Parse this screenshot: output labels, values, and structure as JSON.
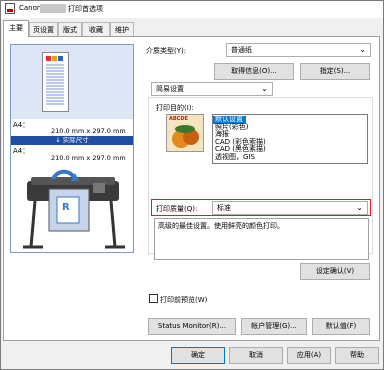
{
  "window": {
    "title_app": "Canon",
    "title_suffix": "打印首选项"
  },
  "tabs": [
    {
      "label": "主要"
    },
    {
      "label": "页设置"
    },
    {
      "label": "版式"
    },
    {
      "label": "收藏"
    },
    {
      "label": "维护"
    }
  ],
  "preview": {
    "info_line1_label": "A4：",
    "info_line1_size": "210.0 mm x 297.0 mm",
    "actual_size_label": "↓ 实际尺寸",
    "info_line2_label": "A4：",
    "info_line2_size": "210.0 mm x 297.0 mm",
    "printer_panel_letter": "R"
  },
  "media": {
    "label": "介质类型(Y):",
    "value": "普通纸",
    "get_info_button": "取得信息(O)...",
    "specify_button": "指定(S)..."
  },
  "mode": {
    "value": "简易设置"
  },
  "purpose": {
    "label": "打印目的(I):",
    "thumbnail_caption": "ABCDE",
    "options": [
      "默认设置",
      "照片(彩色)",
      "海报",
      "CAD (彩色索描)",
      "CAD (黑色素描)",
      "透视图，GIS"
    ],
    "selected_index": 0
  },
  "quality": {
    "label": "打印质量(Q):",
    "value": "标准",
    "description": "高级的最佳设置。使用鲜亮的颜色打印。",
    "confirm_button": "设定确认(V)"
  },
  "preview_before_print": {
    "label": "打印前预览(W)",
    "checked": false
  },
  "bottom_buttons": {
    "status_monitor": "Status Monitor(R)...",
    "account_manage": "帐户管理(G)...",
    "defaults": "默认值(F)"
  },
  "dialog_buttons": {
    "ok": "确定",
    "cancel": "取消",
    "apply": "应用(A)",
    "help": "帮助"
  },
  "colors": {
    "selection": "#0078d7",
    "highlight_box": "#d32020",
    "actual_size_bar": "#1f4ea3"
  }
}
